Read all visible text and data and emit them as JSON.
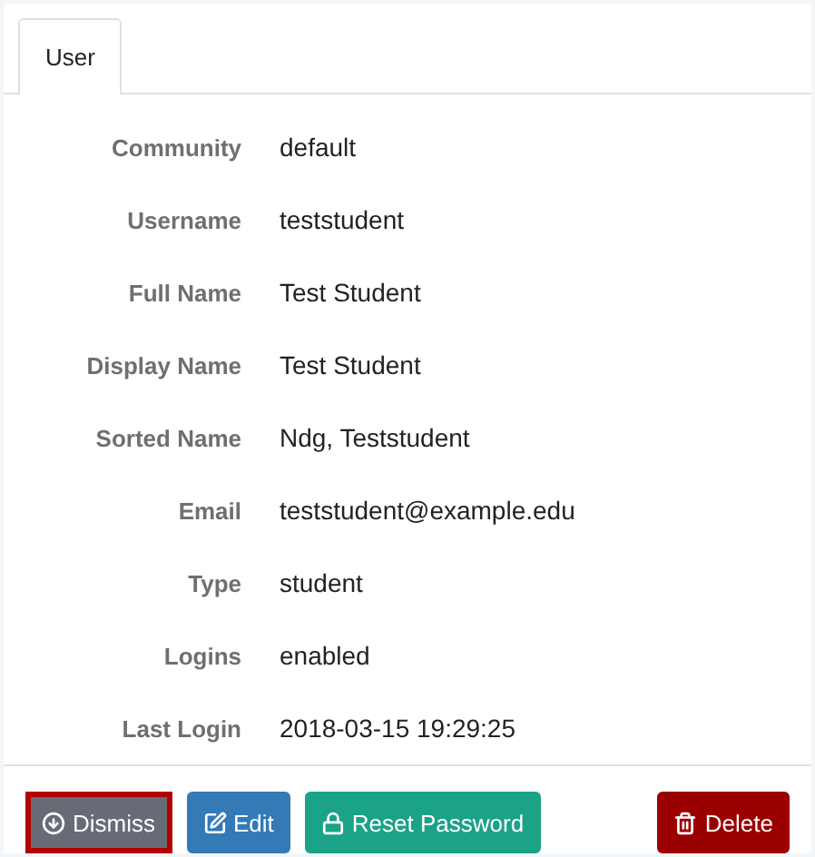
{
  "tabs": [
    {
      "label": "User",
      "selected": true
    }
  ],
  "fields": [
    {
      "label": "Community",
      "value": "default"
    },
    {
      "label": "Username",
      "value": "teststudent"
    },
    {
      "label": "Full Name",
      "value": "Test Student"
    },
    {
      "label": "Display Name",
      "value": "Test Student"
    },
    {
      "label": "Sorted Name",
      "value": "Ndg, Teststudent"
    },
    {
      "label": "Email",
      "value": "teststudent@example.edu"
    },
    {
      "label": "Type",
      "value": "student"
    },
    {
      "label": "Logins",
      "value": "enabled"
    },
    {
      "label": "Last Login",
      "value": "2018-03-15 19:29:25"
    }
  ],
  "buttons": [
    {
      "label": "Dismiss",
      "kind": "default",
      "focused": true
    },
    {
      "label": "Edit",
      "kind": "primary",
      "focused": false
    },
    {
      "label": "Reset Password",
      "kind": "success",
      "focused": false
    },
    {
      "label": "Delete",
      "kind": "danger",
      "focused": false
    }
  ]
}
